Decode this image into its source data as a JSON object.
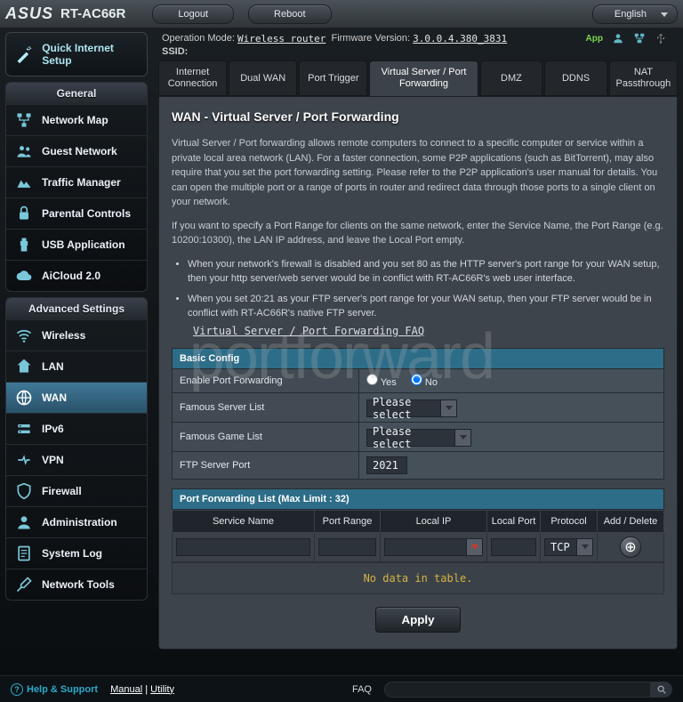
{
  "brand": "ASUS",
  "model": "RT-AC66R",
  "top_buttons": {
    "logout": "Logout",
    "reboot": "Reboot"
  },
  "language": "English",
  "info": {
    "op_mode_label": "Operation Mode:",
    "op_mode_value": "Wireless router",
    "fw_label": "Firmware Version:",
    "fw_value": "3.0.0.4.380_3831",
    "ssid_label": "SSID:",
    "app_label": "App"
  },
  "quick_setup": "Quick Internet Setup",
  "panels": {
    "general_title": "General",
    "general": [
      "Network Map",
      "Guest Network",
      "Traffic Manager",
      "Parental Controls",
      "USB Application",
      "AiCloud 2.0"
    ],
    "advanced_title": "Advanced Settings",
    "advanced": [
      "Wireless",
      "LAN",
      "WAN",
      "IPv6",
      "VPN",
      "Firewall",
      "Administration",
      "System Log",
      "Network Tools"
    ]
  },
  "tabs": [
    "Internet Connection",
    "Dual WAN",
    "Port Trigger",
    "Virtual Server / Port Forwarding",
    "DMZ",
    "DDNS",
    "NAT Passthrough"
  ],
  "page_title": "WAN - Virtual Server / Port Forwarding",
  "desc1": "Virtual Server / Port forwarding allows remote computers to connect to a specific computer or service within a private local area network (LAN). For a faster connection, some P2P applications (such as BitTorrent), may also require that you set the port forwarding setting. Please refer to the P2P application's user manual for details. You can open the multiple port or a range of ports in router and redirect data through those ports to a single client on your network.",
  "desc2": "If you want to specify a Port Range for clients on the same network, enter the Service Name, the Port Range (e.g. 10200:10300), the LAN IP address, and leave the Local Port empty.",
  "bullet1": "When your network's firewall is disabled and you set 80 as the HTTP server's port range for your WAN setup, then your http server/web server would be in conflict with RT-AC66R's web user interface.",
  "bullet2": "When you set 20:21 as your FTP server's port range for your WAN setup, then your FTP server would be in conflict with RT-AC66R's native FTP server.",
  "faq_link": "Virtual Server / Port Forwarding FAQ",
  "basic_config": {
    "section": "Basic Config",
    "enable_label": "Enable Port Forwarding",
    "radio_yes": "Yes",
    "radio_no": "No",
    "famous_server_label": "Famous Server List",
    "famous_game_label": "Famous Game List",
    "please_select": "Please select",
    "ftp_port_label": "FTP Server Port",
    "ftp_port_value": "2021"
  },
  "pf_list": {
    "header": "Port Forwarding List (Max Limit : 32)",
    "cols": [
      "Service Name",
      "Port Range",
      "Local IP",
      "Local Port",
      "Protocol",
      "Add / Delete"
    ],
    "protocol_default": "TCP",
    "no_data": "No data in table."
  },
  "apply": "Apply",
  "footer": {
    "help": "Help & Support",
    "manual": "Manual",
    "utility": "Utility",
    "faq": "FAQ"
  },
  "watermark": "portforward"
}
